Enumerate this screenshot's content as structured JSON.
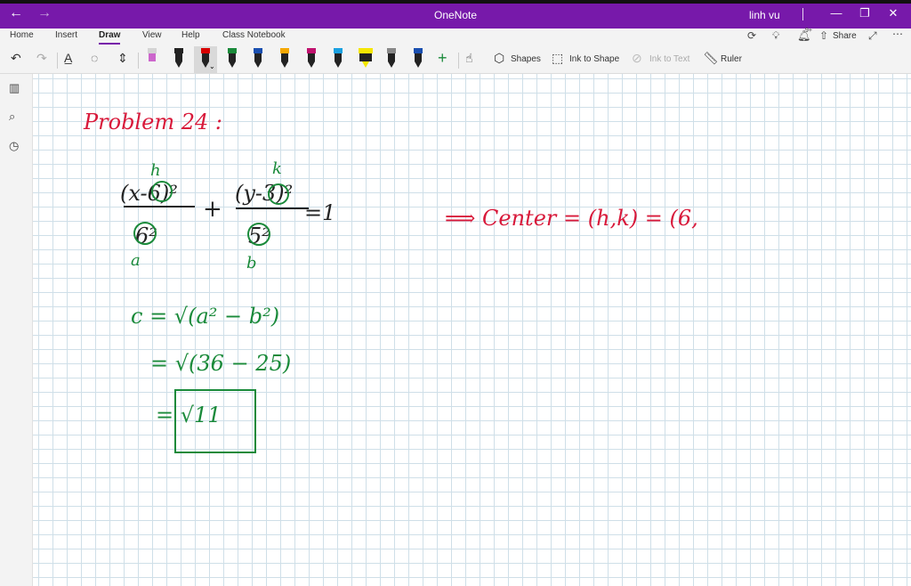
{
  "titlebar": {
    "app_title": "OneNote",
    "user_name": "linh vu"
  },
  "menu": {
    "tabs": [
      {
        "label": "Home"
      },
      {
        "label": "Insert"
      },
      {
        "label": "Draw"
      },
      {
        "label": "View"
      },
      {
        "label": "Help"
      },
      {
        "label": "Class Notebook"
      }
    ],
    "share_label": "Share",
    "notification_count": "9+"
  },
  "toolbar": {
    "shapes_label": "Shapes",
    "ink_to_shape_label": "Ink to Shape",
    "ink_to_text_label": "Ink to Text",
    "ruler_label": "Ruler",
    "pen_colors": [
      "#cc66cc",
      "#222222",
      "#d80000",
      "#1a8a3a",
      "#1a4fb0",
      "#f5a800",
      "#c0126e",
      "#1aa0e0",
      "#f5e600",
      "#222222",
      "#1a4fb0"
    ]
  },
  "ink": {
    "problem_title": "Problem 24 :",
    "equation_left_num": "(x-6)²",
    "equation_left_den": "6²",
    "label_h": "h",
    "label_a": "a",
    "equation_right_num": "(y-3)²",
    "equation_right_den": "5²",
    "label_k": "k",
    "label_b": "b",
    "equals_one": "=1",
    "plus": "+",
    "center_line": "⟹ Center = (h,k) = (6,",
    "step1": "c = √(a² − b²)",
    "step2": "= √(36 − 25)",
    "step3": "= √11",
    "colors": {
      "red": "#d8193a",
      "green": "#1a8a3a",
      "dark": "#222222"
    }
  }
}
